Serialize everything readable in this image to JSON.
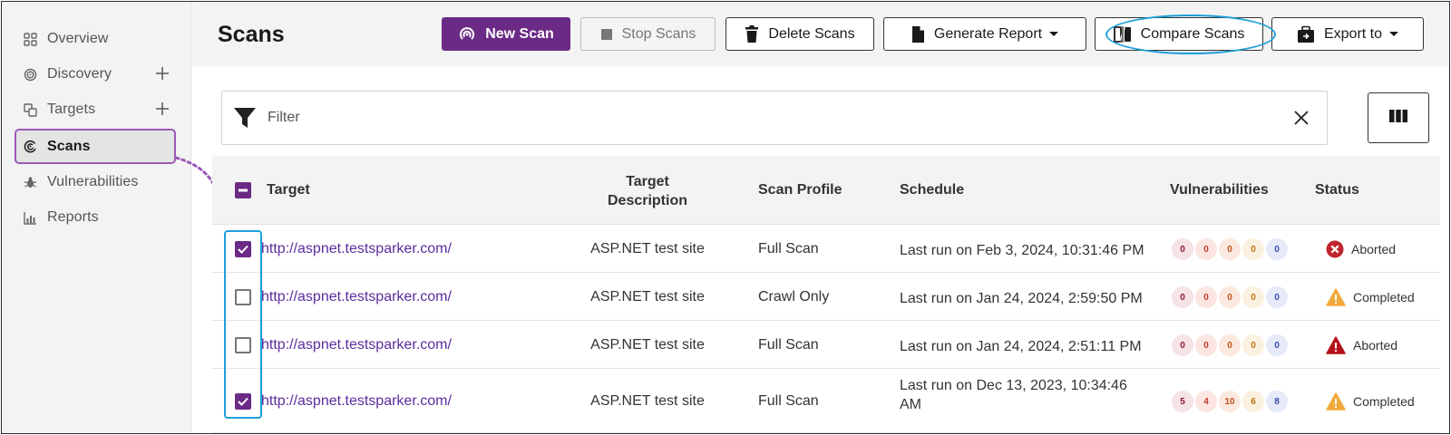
{
  "sidebar": {
    "items": [
      {
        "label": "Overview",
        "icon": "grid-icon",
        "has_add": false
      },
      {
        "label": "Discovery",
        "icon": "target-icon",
        "has_add": true
      },
      {
        "label": "Targets",
        "icon": "targets-icon",
        "has_add": true
      },
      {
        "label": "Scans",
        "icon": "scan-icon",
        "has_add": false,
        "active": true
      },
      {
        "label": "Vulnerabilities",
        "icon": "bug-icon",
        "has_add": false
      },
      {
        "label": "Reports",
        "icon": "chart-icon",
        "has_add": false
      }
    ]
  },
  "header": {
    "title": "Scans",
    "buttons": {
      "new_scan": "New Scan",
      "stop_scans": "Stop Scans",
      "delete_scans": "Delete Scans",
      "generate_report": "Generate Report",
      "compare_scans": "Compare Scans",
      "export_to": "Export to"
    }
  },
  "filter": {
    "placeholder": "Filter"
  },
  "table": {
    "headers": {
      "target": "Target",
      "target_description_line1": "Target",
      "target_description_line2": "Description",
      "scan_profile": "Scan Profile",
      "schedule": "Schedule",
      "vulnerabilities": "Vulnerabilities",
      "status": "Status"
    },
    "rows": [
      {
        "checked": true,
        "target": "http://aspnet.testsparker.com/",
        "description": "ASP.NET test site",
        "profile": "Full Scan",
        "schedule_line1": "Last run on Feb 3, 2024, 10:31:46 PM",
        "schedule_line2": "",
        "vulns": [
          "0",
          "0",
          "0",
          "0",
          "0"
        ],
        "status": "Aborted",
        "status_icon": "x-circle-icon"
      },
      {
        "checked": false,
        "target": "http://aspnet.testsparker.com/",
        "description": "ASP.NET test site",
        "profile": "Crawl Only",
        "schedule_line1": "Last run on Jan 24, 2024, 2:59:50 PM",
        "schedule_line2": "",
        "vulns": [
          "0",
          "0",
          "0",
          "0",
          "0"
        ],
        "status": "Completed",
        "status_icon": "warning-icon"
      },
      {
        "checked": false,
        "target": "http://aspnet.testsparker.com/",
        "description": "ASP.NET test site",
        "profile": "Full Scan",
        "schedule_line1": "Last run on Jan 24, 2024, 2:51:11 PM",
        "schedule_line2": "",
        "vulns": [
          "0",
          "0",
          "0",
          "0",
          "0"
        ],
        "status": "Aborted",
        "status_icon": "alert-triangle-icon"
      },
      {
        "checked": true,
        "target": "http://aspnet.testsparker.com/",
        "description": "ASP.NET test site",
        "profile": "Full Scan",
        "schedule_line1": "Last run on Dec 13, 2023, 10:34:46",
        "schedule_line2": "AM",
        "vulns": [
          "5",
          "4",
          "10",
          "6",
          "8"
        ],
        "status": "Completed",
        "status_icon": "warning-icon"
      }
    ]
  },
  "colors": {
    "accent": "#6b2a86",
    "highlight": "#1e9fd8",
    "arrow": "#9b59b6",
    "vuln_critical_bg": "#f6e3e6",
    "vuln_critical_fg": "#8b1a2b",
    "vuln_high_bg": "#fbe6e2",
    "vuln_high_fg": "#c0392b",
    "vuln_medium_bg": "#fbe9df",
    "vuln_medium_fg": "#c0521b",
    "vuln_low_bg": "#fbf1e0",
    "vuln_low_fg": "#b9770e",
    "vuln_info_bg": "#e6e9f8",
    "vuln_info_fg": "#3b4ba8"
  }
}
